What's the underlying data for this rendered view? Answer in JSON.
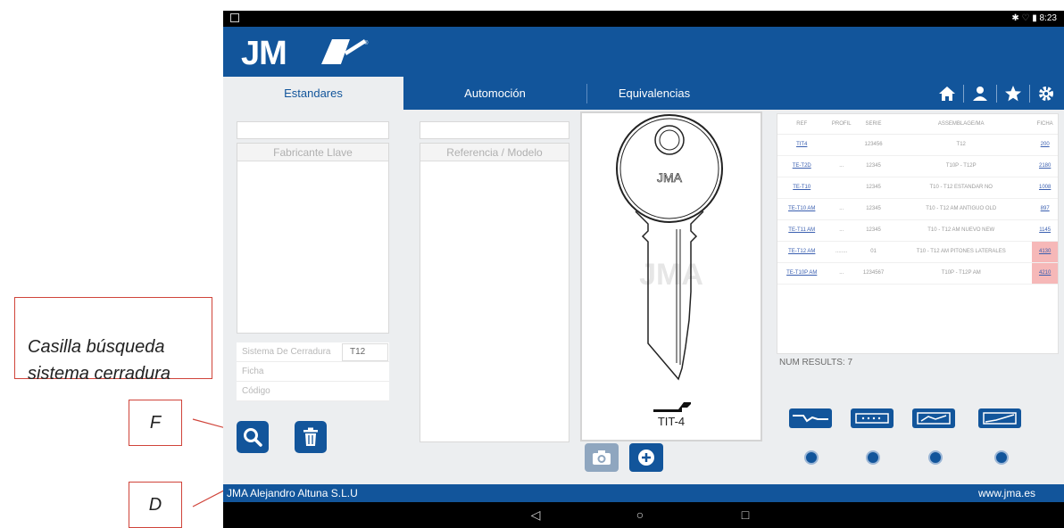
{
  "status_bar": {
    "time": "8:23"
  },
  "brand": {
    "logo_text": "JMA",
    "primary_color": "#12559b"
  },
  "tabs": [
    {
      "label": "Estandares",
      "active": true
    },
    {
      "label": "Automoción",
      "active": false
    },
    {
      "label": "Equivalencias",
      "active": false
    }
  ],
  "top_icons": [
    "home-icon",
    "user-icon",
    "star-icon",
    "settings-icon"
  ],
  "left_panel": {
    "manufacturer_header": "Fabricante Llave",
    "fields": {
      "lock_system_label": "Sistema De Cerradura",
      "lock_system_value": "T12",
      "ficha_label": "Ficha",
      "codigo_label": "Código"
    }
  },
  "middle_panel": {
    "model_header": "Referencia / Modelo"
  },
  "key_card": {
    "code": "TIT-4",
    "watermark": "JMA"
  },
  "results": {
    "columns": [
      "REF",
      "PROFIL",
      "SERIE",
      "ASSEMBLAGE/MA",
      "FICHA"
    ],
    "rows": [
      [
        "TIT4",
        "",
        "123456",
        "T12",
        "200"
      ],
      [
        "TE-T2D",
        "...",
        "12345",
        "T10P - T12P",
        "2180"
      ],
      [
        "TE-T10",
        "",
        "12345",
        "T10 - T12 ESTANDAR NO",
        "1008"
      ],
      [
        "TE-T10 AM",
        "...",
        "12345",
        "T10 - T12 AM ANTIGUO OLD",
        "897"
      ],
      [
        "TE-T11 AM",
        "...",
        "12345",
        "T10 - T12 AM NUEVO NEW",
        "1145"
      ],
      [
        "TE-T12 AM",
        "........",
        "01",
        "T10 - T12 AM PITONES LATERALES",
        "4130"
      ],
      [
        "TE-T10P AM",
        "...",
        "1234567",
        "T10P - T12P AM",
        "4210"
      ]
    ],
    "num_results": "NUM RESULTS: 7"
  },
  "footer": {
    "company": "JMA Alejandro Altuna S.L.U",
    "website": "www.jma.es"
  },
  "annotations": {
    "casilla": "Casilla búsqueda\nsistema cerradura",
    "f": "F",
    "d": "D"
  }
}
